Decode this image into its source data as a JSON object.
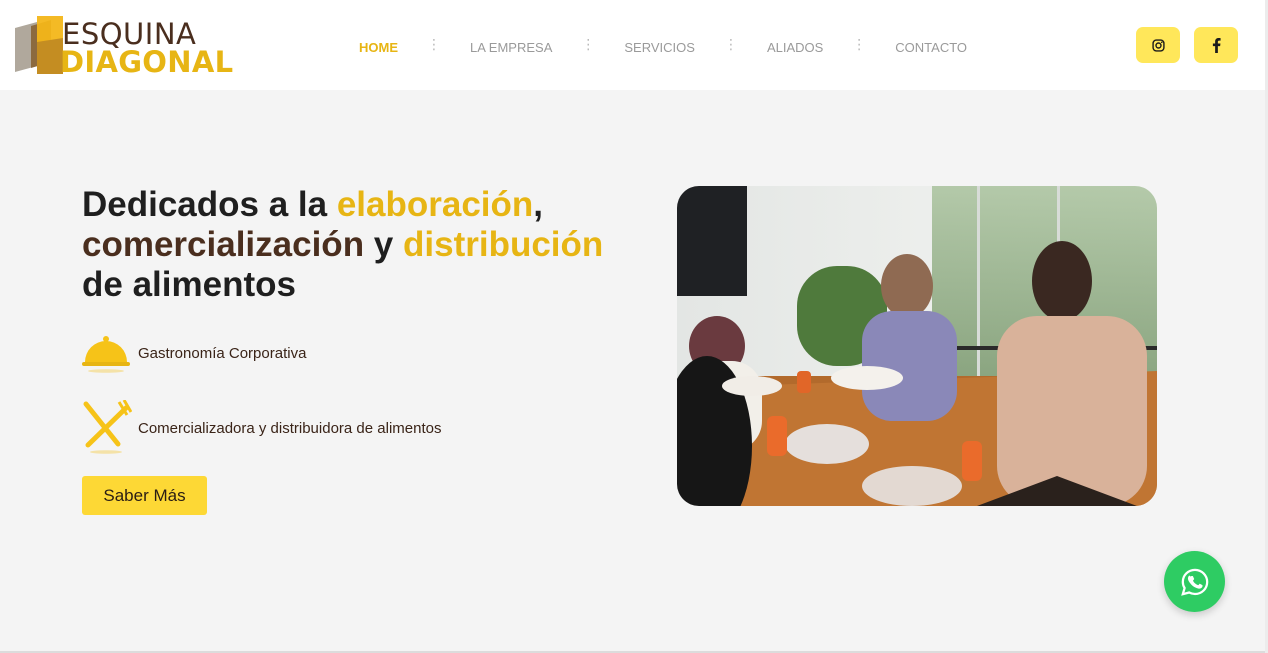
{
  "brand": {
    "name_line1": "ESQUINA",
    "name_line2": "DIAGONAL",
    "colors": {
      "yellow": "#e7b514",
      "brown": "#4a2e1e",
      "button": "#fdd835",
      "social": "#ffe75a",
      "whatsapp": "#2ecc63"
    }
  },
  "nav": {
    "items": [
      {
        "label": "HOME",
        "active": true
      },
      {
        "label": "LA EMPRESA",
        "active": false
      },
      {
        "label": "SERVICIOS",
        "active": false
      },
      {
        "label": "ALIADOS",
        "active": false
      },
      {
        "label": "CONTACTO",
        "active": false
      }
    ]
  },
  "social": {
    "instagram_icon": "instagram-icon",
    "facebook_icon": "facebook-icon"
  },
  "hero": {
    "title_part1": "Dedicados a la ",
    "title_hl1": "elaboración",
    "title_part2": ",",
    "title_hl2": "comercialización",
    "title_part3": " y ",
    "title_hl3": "distribución",
    "title_part4": "de alimentos",
    "features": [
      {
        "icon": "cloche-icon",
        "label": "Gastronomía Corporativa"
      },
      {
        "icon": "fork-knife-icon",
        "label": "Comercializadora y distribuidora de alimentos"
      }
    ],
    "cta_label": "Saber Más"
  },
  "whatsapp": {
    "icon": "whatsapp-icon"
  }
}
